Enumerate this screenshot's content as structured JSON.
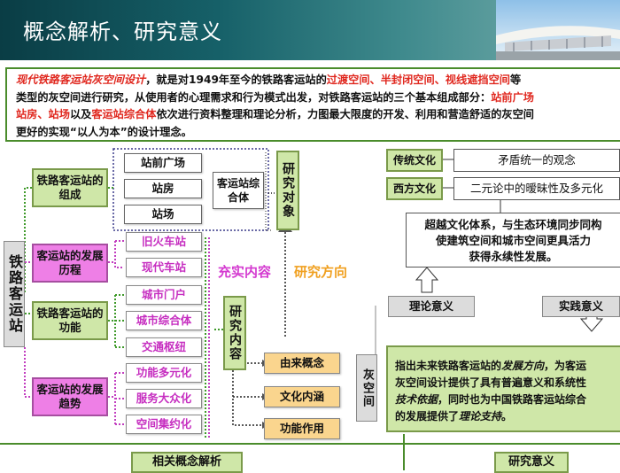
{
  "header": {
    "title": "概念解析、研究意义"
  },
  "intro": {
    "line1": [
      "现代铁路客运站灰空间设计",
      "，就是对1949年至今的铁路客运站的",
      "过渡空间、半封闭空间、视线遮挡空间",
      "等"
    ],
    "line2": [
      "类型的灰空间进行研究，从使用者的心理需求和行为模式出发，对铁路客运站的三个基本组成部分：",
      "站前广场"
    ],
    "line3": [
      "站房、站场",
      "以及",
      "客运站综合体",
      "依次进行资料整理和理论分析，力图最大限度的开发、利用和营造舒适的灰空间"
    ],
    "line4": "更好的实现“以人为本”的设计理念。"
  },
  "diagram": {
    "root": "铁路客运站",
    "categories": [
      "铁路客运站的组成",
      "客运站的发展历程",
      "铁路客运站的功能",
      "客运站的发展趋势"
    ],
    "composition_items": [
      "站前广场",
      "站房",
      "站场"
    ],
    "complex": "客运站综合体",
    "history_items": [
      "旧火车站",
      "现代车站"
    ],
    "function_items": [
      "城市门户",
      "城市综合体",
      "交通枢纽"
    ],
    "trend_items": [
      "功能多元化",
      "服务大众化",
      "空间集约化"
    ],
    "research_object": "研究对象",
    "research_content": "研究内容",
    "supplement_label": "充实内容",
    "direction_label": "研究方向",
    "grey_space": "灰空间",
    "grey_items": [
      "由来概念",
      "文化内涵",
      "功能作用"
    ],
    "culture": [
      {
        "label": "传统文化",
        "desc": "矛盾统一的观念"
      },
      {
        "label": "西方文化",
        "desc": "二元论中的暧昧性及多元化"
      }
    ],
    "transcend": [
      "超越文化体系，与生态环境同步同构",
      "使建筑空间和城市空间更具活力",
      "获得永续性发展。"
    ],
    "theory": "理论意义",
    "practice": "实践意义",
    "practice_text": {
      "l1": [
        "指出未来铁路客运站的",
        "发展方向",
        "，为客运"
      ],
      "l2": "灰空间设计提供了具有普遍意义和系统性",
      "l3": [
        "技术依据",
        "，同时也为中国铁路客运站综合"
      ],
      "l4": [
        "的发展提供了",
        "理论支持",
        "。"
      ]
    }
  },
  "footer": {
    "left_tab": "相关概念解析",
    "right_tab": "研究意义"
  },
  "colors": {
    "header_bg": "#166068",
    "green_border": "#4a8c2b",
    "highlight": "#e0281f",
    "magenta": "#c62ec0",
    "orange_label": "#f0a020",
    "pink": "#ee7fe6",
    "light_green": "#cfe7a8"
  }
}
